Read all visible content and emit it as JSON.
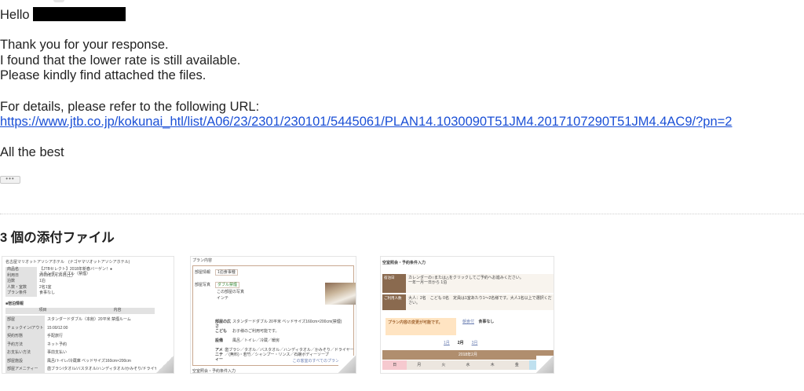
{
  "email": {
    "greeting": "Hello",
    "lines": [
      "Thank you for your response.",
      "I found that the lower rate is still available.",
      "Please kindly find attached the files."
    ],
    "details_intro": "For details, please refer to the following URL:",
    "url": "https://www.jtb.co.jp/kokunai_htl/list/A06/23/2301/230101/5445061/PLAN14.1030090T51JM4.2017107290T51JM4.4AC9/?pn=2",
    "signoff": "All the best",
    "trimmed_button_label": "•••"
  },
  "attachments": {
    "heading": "3 個の添付ファイル",
    "thumb1": {
      "title": "名古屋マリオットアソシアホテル　(ナゴヤマリオットアソシアホテル)",
      "rows": [
        {
          "k": "商品名",
          "v": "【JTBセレクト】2018年新春バーゲン！●スタンダードダブル（禁煙）"
        },
        {
          "k": "利用日",
          "v": "2018年2月16日(土)"
        },
        {
          "k": "泊数",
          "v": "1泊"
        },
        {
          "k": "人数・室数",
          "v": "2名1室"
        },
        {
          "k": "プラン条件",
          "v": "食事なし"
        }
      ],
      "section": "■宿泊情報",
      "head": [
        "項目",
        "内容"
      ],
      "rows2": [
        {
          "k": "部屋",
          "v": "スタンダードダブル（本館）20平米 禁煙ルーム"
        },
        {
          "k": "チェックイン/アウト",
          "v": "15:00/12:00"
        },
        {
          "k": "契約形態",
          "v": "手配旅行"
        },
        {
          "k": "予約方法",
          "v": "ネット予約"
        },
        {
          "k": "お支払い方法",
          "v": "事前支払い"
        },
        {
          "k": "部屋施設",
          "v": "風呂/トイレ/冷蔵庫 ベッドサイズ160cm×200cm"
        },
        {
          "k": "部屋アメニティー",
          "v": "歯ブラシ/タオル/バスタオル/ハンディタオル/かみそり/ドライヤー/シャンプー/リンス/石鹸/ボディーソープ"
        }
      ]
    },
    "thumb2": {
      "label": "プラン内容",
      "row1_key": "部屋情報",
      "row1_tag": "1泊食事種",
      "row2_key": "部屋写真",
      "row2_tag": "ダブル禁煙",
      "row2_note": "この部屋の写真",
      "row2_note2": "インテ",
      "inner": [
        {
          "k": "部屋の広さ",
          "v": "スタンダードダブル 20平米 ベッドサイズ160cm×200cm(禁煙)"
        },
        {
          "k": "こども",
          "v": "お子様のご利用可能です。"
        },
        {
          "k": "設備",
          "v": "風呂／トイレ／冷蔵／暖房"
        },
        {
          "k": "アメニティー",
          "v": "歯ブラシ／タオル／バスタオル／ハンディタオル／かみそり／ドライヤー／(無料)・若竹／シャンプー・リンス／石鹸ボディーソープ"
        }
      ],
      "footer_link": "この客室のすべてのプランを見る",
      "footer2": "空室照会・予約条件入力"
    },
    "thumb3": {
      "title": "空室照会・予約条件入力",
      "row1_label": "宿泊日",
      "row1_text": "カレンダーの○または△をクリックしてご予約へお進みください。",
      "row1_sub": "一年一月一日から",
      "row1_stay": "1泊",
      "row2_label": "ご利用人数",
      "row2_text": "大人：2名　こども 0名　定員は1室あたり1〜2名様です。大人1名以上で選択ください。",
      "note": "プラン内容の変更が可能です。",
      "plan_label": "朝食付",
      "plan_value": "食事なし",
      "months": [
        "1月",
        "2月",
        "3月"
      ],
      "cal_title": "2018年2月",
      "weekdays": [
        "日",
        "月",
        "火",
        "水",
        "木",
        "金",
        "土"
      ]
    }
  }
}
